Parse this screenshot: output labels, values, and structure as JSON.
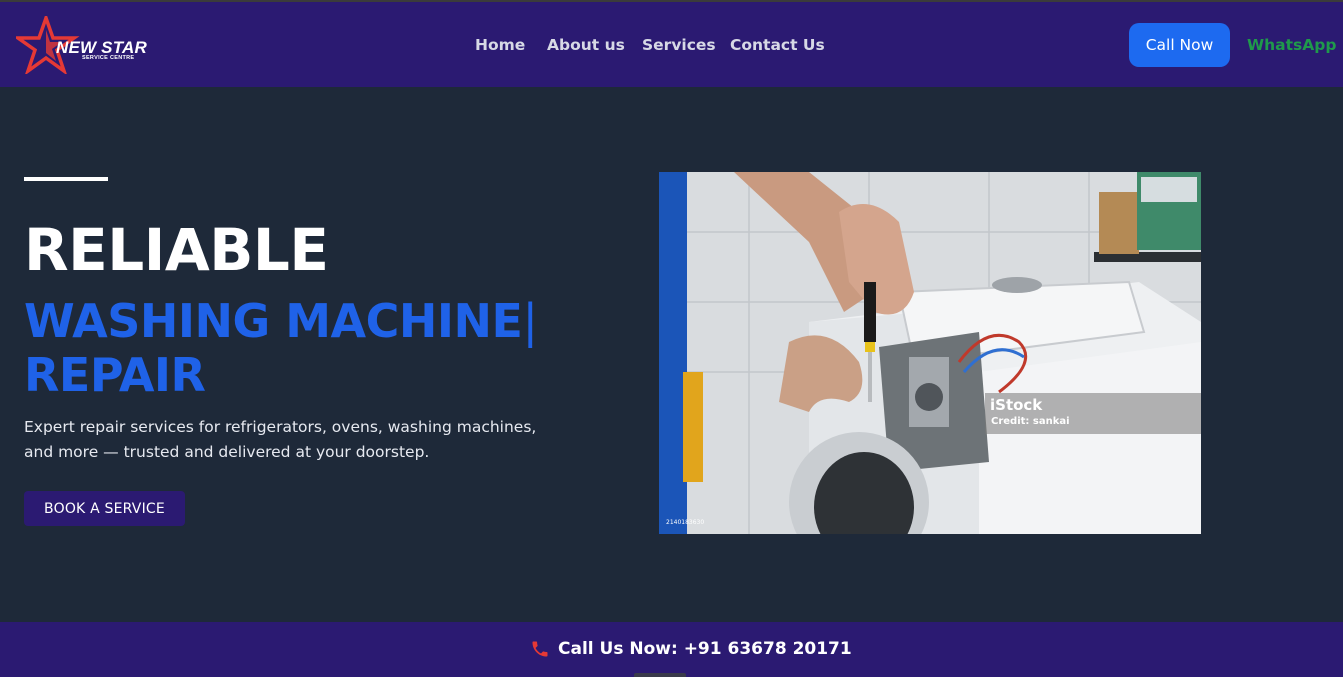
{
  "logo": {
    "name": "NEW STAR",
    "subtitle": "SERVICE CENTRE",
    "star_color": "#e53935"
  },
  "nav": {
    "items": [
      {
        "label": "Home"
      },
      {
        "label": "About us"
      },
      {
        "label": "Services"
      },
      {
        "label": "Contact Us"
      }
    ],
    "call_label": "Call Now",
    "whatsapp_label": "WhatsApp"
  },
  "hero": {
    "headline": "RELIABLE",
    "typed_text": "WASHING MACHINE",
    "typed_cursor": "|",
    "typed_text_2": "REPAIR",
    "description": "Expert repair services for refrigerators, ovens, washing machines, and more — trusted and delivered at your doorstep.",
    "cta_label": "BOOK A SERVICE",
    "image": {
      "watermark": "iStock",
      "credit": "Credit: sankai",
      "stock_id": "2140183630"
    }
  },
  "callbar": {
    "text": "Call Us Now: +91 63678 20171",
    "icon": "phone-icon"
  },
  "colors": {
    "nav_bg": "#2b1a72",
    "page_bg": "#1e2939",
    "accent_blue": "#1f62e8",
    "call_button": "#1d6af0",
    "whatsapp_green": "#1f9a4b"
  }
}
